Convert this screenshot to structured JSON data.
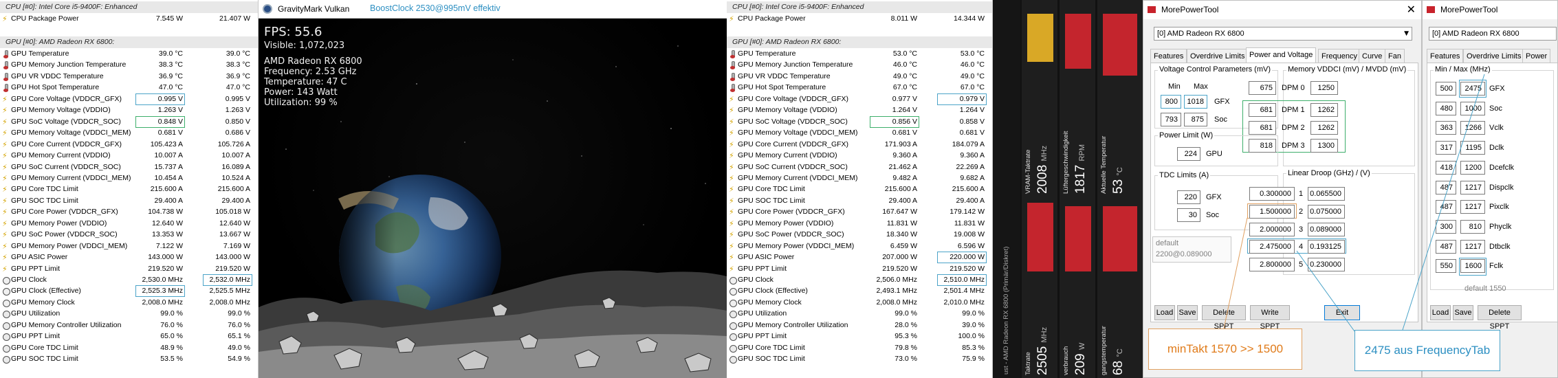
{
  "hwinfo_left": {
    "cpu_header": "CPU [#0]: Intel Core i5-9400F: Enhanced",
    "gpu_header": "GPU [#0]: AMD Radeon RX 6800:",
    "cpu_rows": [
      {
        "label": "CPU Package Power",
        "v1": "7.545 W",
        "v2": "21.407 W",
        "icon": "bolt-icon"
      }
    ],
    "gpu_rows": [
      {
        "label": "GPU Temperature",
        "v1": "39.0 °C",
        "v2": "39.0 °C",
        "icon": "thermometer-icon"
      },
      {
        "label": "GPU Memory Junction Temperature",
        "v1": "38.3 °C",
        "v2": "38.3 °C",
        "icon": "thermometer-icon"
      },
      {
        "label": "GPU VR VDDC Temperature",
        "v1": "36.9 °C",
        "v2": "36.9 °C",
        "icon": "thermometer-icon"
      },
      {
        "label": "GPU Hot Spot Temperature",
        "v1": "47.0 °C",
        "v2": "47.0 °C",
        "icon": "thermometer-icon"
      },
      {
        "label": "GPU Core Voltage (VDDCR_GFX)",
        "v1": "0.995 V",
        "v2": "0.995 V",
        "icon": "bolt-icon",
        "box1": "blue"
      },
      {
        "label": "GPU Memory Voltage (VDDIO)",
        "v1": "1.263 V",
        "v2": "1.263 V",
        "icon": "bolt-icon"
      },
      {
        "label": "GPU SoC Voltage (VDDCR_SOC)",
        "v1": "0.848 V",
        "v2": "0.850 V",
        "icon": "bolt-icon",
        "box1": "green"
      },
      {
        "label": "GPU Memory Voltage (VDDCI_MEM)",
        "v1": "0.681 V",
        "v2": "0.686 V",
        "icon": "bolt-icon"
      },
      {
        "label": "GPU Core Current (VDDCR_GFX)",
        "v1": "105.423 A",
        "v2": "105.726 A",
        "icon": "bolt-icon"
      },
      {
        "label": "GPU Memory Current (VDDIO)",
        "v1": "10.007 A",
        "v2": "10.007 A",
        "icon": "bolt-icon"
      },
      {
        "label": "GPU SoC Current (VDDCR_SOC)",
        "v1": "15.737 A",
        "v2": "16.089 A",
        "icon": "bolt-icon"
      },
      {
        "label": "GPU Memory Current (VDDCI_MEM)",
        "v1": "10.454 A",
        "v2": "10.524 A",
        "icon": "bolt-icon"
      },
      {
        "label": "GPU Core TDC Limit",
        "v1": "215.600 A",
        "v2": "215.600 A",
        "icon": "bolt-icon"
      },
      {
        "label": "GPU SOC TDC Limit",
        "v1": "29.400 A",
        "v2": "29.400 A",
        "icon": "bolt-icon"
      },
      {
        "label": "GPU Core Power (VDDCR_GFX)",
        "v1": "104.738 W",
        "v2": "105.018 W",
        "icon": "bolt-icon"
      },
      {
        "label": "GPU Memory Power (VDDIO)",
        "v1": "12.640 W",
        "v2": "12.640 W",
        "icon": "bolt-icon"
      },
      {
        "label": "GPU SoC Power (VDDCR_SOC)",
        "v1": "13.353 W",
        "v2": "13.667 W",
        "icon": "bolt-icon"
      },
      {
        "label": "GPU Memory Power (VDDCI_MEM)",
        "v1": "7.122 W",
        "v2": "7.169 W",
        "icon": "bolt-icon"
      },
      {
        "label": "GPU ASIC Power",
        "v1": "143.000 W",
        "v2": "143.000 W",
        "icon": "bolt-icon"
      },
      {
        "label": "GPU PPT Limit",
        "v1": "219.520 W",
        "v2": "219.520 W",
        "icon": "bolt-icon"
      },
      {
        "label": "GPU Clock",
        "v1": "2,530.0 MHz",
        "v2": "2,532.0 MHz",
        "icon": "clock-icon",
        "box2": "blue"
      },
      {
        "label": "GPU Clock (Effective)",
        "v1": "2,525.3 MHz",
        "v2": "2,525.5 MHz",
        "icon": "clock-icon",
        "box1": "blue"
      },
      {
        "label": "GPU Memory Clock",
        "v1": "2,008.0 MHz",
        "v2": "2,008.0 MHz",
        "icon": "clock-icon"
      },
      {
        "label": "GPU Utilization",
        "v1": "99.0 %",
        "v2": "99.0 %",
        "icon": "percent-icon"
      },
      {
        "label": "GPU Memory Controller Utilization",
        "v1": "76.0 %",
        "v2": "76.0 %",
        "icon": "percent-icon"
      },
      {
        "label": "GPU PPT Limit",
        "v1": "65.0 %",
        "v2": "65.1 %",
        "icon": "percent-icon"
      },
      {
        "label": "GPU Core TDC Limit",
        "v1": "48.9 %",
        "v2": "49.0 %",
        "icon": "percent-icon"
      },
      {
        "label": "GPU SOC TDC Limit",
        "v1": "53.5 %",
        "v2": "54.9 %",
        "icon": "percent-icon"
      }
    ]
  },
  "gravitymark": {
    "title": "GravityMark Vulkan",
    "note": "BoostClock 2530@995mV effektiv",
    "fps": "FPS: 55.6",
    "visible": "Visible: 1,072,023",
    "gpu": "AMD Radeon RX 6800",
    "frequency": "Frequency: 2.53 GHz",
    "temperature": "Temperature: 47 C",
    "power": "Power: 143 Watt",
    "utilization": "Utilization: 99 %"
  },
  "hwinfo_right": {
    "cpu_header": "CPU [#0]: Intel Core i5-9400F: Enhanced",
    "gpu_header": "GPU [#0]: AMD Radeon RX 6800:",
    "cpu_rows": [
      {
        "label": "CPU Package Power",
        "v1": "8.011 W",
        "v2": "14.344 W",
        "icon": "bolt-icon"
      }
    ],
    "gpu_rows": [
      {
        "label": "GPU Temperature",
        "v1": "53.0 °C",
        "v2": "53.0 °C",
        "icon": "thermometer-icon"
      },
      {
        "label": "GPU Memory Junction Temperature",
        "v1": "46.0 °C",
        "v2": "46.0 °C",
        "icon": "thermometer-icon"
      },
      {
        "label": "GPU VR VDDC Temperature",
        "v1": "49.0 °C",
        "v2": "49.0 °C",
        "icon": "thermometer-icon"
      },
      {
        "label": "GPU Hot Spot Temperature",
        "v1": "67.0 °C",
        "v2": "67.0 °C",
        "icon": "thermometer-icon"
      },
      {
        "label": "GPU Core Voltage (VDDCR_GFX)",
        "v1": "0.977 V",
        "v2": "0.979 V",
        "icon": "bolt-icon",
        "box2": "blue"
      },
      {
        "label": "GPU Memory Voltage (VDDIO)",
        "v1": "1.264 V",
        "v2": "1.264 V",
        "icon": "bolt-icon"
      },
      {
        "label": "GPU SoC Voltage (VDDCR_SOC)",
        "v1": "0.856 V",
        "v2": "0.858 V",
        "icon": "bolt-icon",
        "box1": "green"
      },
      {
        "label": "GPU Memory Voltage (VDDCI_MEM)",
        "v1": "0.681 V",
        "v2": "0.681 V",
        "icon": "bolt-icon"
      },
      {
        "label": "GPU Core Current (VDDCR_GFX)",
        "v1": "171.903 A",
        "v2": "184.079 A",
        "icon": "bolt-icon"
      },
      {
        "label": "GPU Memory Current (VDDIO)",
        "v1": "9.360 A",
        "v2": "9.360 A",
        "icon": "bolt-icon"
      },
      {
        "label": "GPU SoC Current (VDDCR_SOC)",
        "v1": "21.462 A",
        "v2": "22.269 A",
        "icon": "bolt-icon"
      },
      {
        "label": "GPU Memory Current (VDDCI_MEM)",
        "v1": "9.482 A",
        "v2": "9.682 A",
        "icon": "bolt-icon"
      },
      {
        "label": "GPU Core TDC Limit",
        "v1": "215.600 A",
        "v2": "215.600 A",
        "icon": "bolt-icon"
      },
      {
        "label": "GPU SOC TDC Limit",
        "v1": "29.400 A",
        "v2": "29.400 A",
        "icon": "bolt-icon"
      },
      {
        "label": "GPU Core Power (VDDCR_GFX)",
        "v1": "167.647 W",
        "v2": "179.142 W",
        "icon": "bolt-icon"
      },
      {
        "label": "GPU Memory Power (VDDIO)",
        "v1": "11.831 W",
        "v2": "11.831 W",
        "icon": "bolt-icon"
      },
      {
        "label": "GPU SoC Power (VDDCR_SOC)",
        "v1": "18.340 W",
        "v2": "19.008 W",
        "icon": "bolt-icon"
      },
      {
        "label": "GPU Memory Power (VDDCI_MEM)",
        "v1": "6.459 W",
        "v2": "6.596 W",
        "icon": "bolt-icon"
      },
      {
        "label": "GPU ASIC Power",
        "v1": "207.000 W",
        "v2": "220.000 W",
        "icon": "bolt-icon",
        "box2": "blue"
      },
      {
        "label": "GPU PPT Limit",
        "v1": "219.520 W",
        "v2": "219.520 W",
        "icon": "bolt-icon"
      },
      {
        "label": "GPU Clock",
        "v1": "2,506.0 MHz",
        "v2": "2,510.0 MHz",
        "icon": "clock-icon",
        "box2": "blue"
      },
      {
        "label": "GPU Clock (Effective)",
        "v1": "2,493.1 MHz",
        "v2": "2,501.4 MHz",
        "icon": "clock-icon"
      },
      {
        "label": "GPU Memory Clock",
        "v1": "2,008.0 MHz",
        "v2": "2,010.0 MHz",
        "icon": "clock-icon"
      },
      {
        "label": "GPU Utilization",
        "v1": "99.0 %",
        "v2": "99.0 %",
        "icon": "percent-icon"
      },
      {
        "label": "GPU Memory Controller Utilization",
        "v1": "28.0 %",
        "v2": "39.0 %",
        "icon": "percent-icon"
      },
      {
        "label": "GPU PPT Limit",
        "v1": "95.3 %",
        "v2": "100.0 %",
        "icon": "percent-icon"
      },
      {
        "label": "GPU Core TDC Limit",
        "v1": "79.8 %",
        "v2": "85.3 %",
        "icon": "percent-icon"
      },
      {
        "label": "GPU SOC TDC Limit",
        "v1": "73.0 %",
        "v2": "75.9 %",
        "icon": "percent-icon"
      }
    ]
  },
  "radeon_overlay": {
    "top": [
      {
        "label": "VRAM-Taktrate",
        "value": "2008",
        "unit": "MHz"
      },
      {
        "label": "Lüftergeschwindigkeit",
        "value": "1817",
        "unit": "RPM"
      },
      {
        "label": "Aktuelle Temperatur",
        "value": "53",
        "unit": "°C"
      }
    ],
    "bottom": [
      {
        "label": "Taktrate",
        "value": "2505",
        "unit": "MHz"
      },
      {
        "label": "verbrauch",
        "value": "209",
        "unit": "W"
      },
      {
        "label": "gangstemperatur",
        "value": "68",
        "unit": "°C"
      }
    ],
    "side_label": "AMD Radeon RX 6800 (Primär/Diskret)",
    "side_prefix": "ust -",
    "accent": "#c4252d",
    "gold": "#d9a826"
  },
  "mpt_main": {
    "title": "MorePowerTool",
    "close": "✕",
    "device": "[0] AMD Radeon RX 6800",
    "tabs": [
      "Features",
      "Overdrive Limits",
      "Power and Voltage",
      "Frequency",
      "Curve",
      "Fan"
    ],
    "vcp": {
      "title": "Voltage Control Parameters (mV)",
      "min_label": "Min",
      "max_label": "Max",
      "gfx_label": "GFX",
      "soc_label": "Soc",
      "gfx_min": "800",
      "gfx_max": "1018",
      "soc_min": "793",
      "soc_max": "875"
    },
    "mem": {
      "title": "Memory VDDCI (mV) / MVDD (mV)",
      "rows": [
        {
          "left": "675",
          "label": "DPM 0",
          "right": "1250"
        },
        {
          "left": "681",
          "label": "DPM 1",
          "right": "1262"
        },
        {
          "left": "681",
          "label": "DPM 2",
          "right": "1262"
        },
        {
          "left": "818",
          "label": "DPM 3",
          "right": "1300"
        }
      ]
    },
    "power": {
      "title": "Power Limit (W)",
      "value": "224",
      "label": "GPU"
    },
    "tdc": {
      "title": "TDC Limits (A)",
      "gfx_value": "220",
      "gfx_label": "GFX",
      "soc_value": "30",
      "soc_label": "Soc"
    },
    "default_note": "default",
    "default_value": "2200@0.089000",
    "droop": {
      "title": "Linear Droop (GHz) / (V)",
      "rows": [
        {
          "left": "0.300000",
          "idx": "1",
          "right": "0.065500"
        },
        {
          "left": "1.500000",
          "idx": "2",
          "right": "0.075000"
        },
        {
          "left": "2.000000",
          "idx": "3",
          "right": "0.089000"
        },
        {
          "left": "2.475000",
          "idx": "4",
          "right": "0.193125"
        },
        {
          "left": "2.800000",
          "idx": "5",
          "right": "0.230000"
        }
      ]
    },
    "buttons": {
      "load": "Load",
      "save": "Save",
      "delete": "Delete SPPT",
      "write": "Write SPPT",
      "exit": "Exit"
    }
  },
  "mpt_second": {
    "title": "MorePowerTool",
    "device": "[0] AMD Radeon RX 6800",
    "tabs": [
      "Features",
      "Overdrive Limits",
      "Power"
    ],
    "freq_title": "Min / Max (MHz)",
    "rows": [
      {
        "min": "500",
        "max": "2475",
        "label": "GFX"
      },
      {
        "min": "480",
        "max": "1000",
        "label": "Soc"
      },
      {
        "min": "363",
        "max": "1266",
        "label": "Vclk"
      },
      {
        "min": "317",
        "max": "1195",
        "label": "Dclk"
      },
      {
        "min": "418",
        "max": "1200",
        "label": "Dcefclk"
      },
      {
        "min": "487",
        "max": "1217",
        "label": "Dispclk"
      },
      {
        "min": "487",
        "max": "1217",
        "label": "Pixclk"
      },
      {
        "min": "300",
        "max": "810",
        "label": "Phyclk"
      },
      {
        "min": "487",
        "max": "1217",
        "label": "Dtbclk"
      },
      {
        "min": "550",
        "max": "1600",
        "label": "Fclk"
      }
    ],
    "default_note": "default 1550",
    "buttons": {
      "load": "Load",
      "save": "Save",
      "delete": "Delete SPPT"
    }
  },
  "callouts": {
    "min_takt": "minTakt 1570 >> 1500",
    "freq_tab": "2475 aus FrequencyTab"
  }
}
